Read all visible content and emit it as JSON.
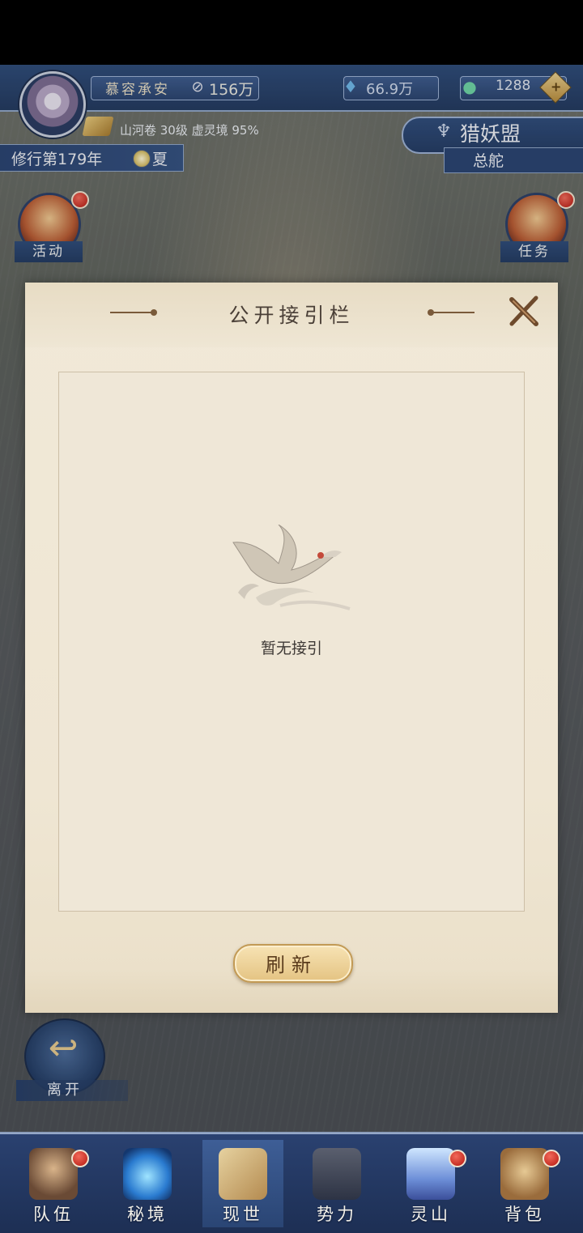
{
  "player": {
    "name": "慕容承安",
    "power": "156万",
    "realm_info": "山河卷 30级 虚灵境 95%",
    "year": "修行第179年",
    "season": "夏"
  },
  "currency": {
    "spirit_stones": "66.9万",
    "jade": "1288"
  },
  "guild": {
    "name": "猎妖盟",
    "location": "总舵"
  },
  "side_buttons": {
    "activity": "活动",
    "quest": "任务"
  },
  "dialog": {
    "title": "公开接引栏",
    "empty_text": "暂无接引",
    "refresh_label": "刷新"
  },
  "return_label": "离开",
  "nav": [
    {
      "label": "队伍",
      "badge": true
    },
    {
      "label": "秘境",
      "badge": false
    },
    {
      "label": "现世",
      "badge": false,
      "active": true
    },
    {
      "label": "势力",
      "badge": false
    },
    {
      "label": "灵山",
      "badge": true
    },
    {
      "label": "背包",
      "badge": true
    }
  ],
  "colors": {
    "header_blue": "#2e4a78",
    "parchment": "#f1e9d8",
    "badge_red": "#b5170f",
    "refresh_gold": "#e4c382"
  },
  "icons": {
    "power": "no-sword-icon",
    "spirit_stones": "crystal-icon",
    "jade": "jade-coin-icon",
    "guild": "guild-emblem-icon",
    "close": "close-icon",
    "empty": "crane-icon",
    "return": "back-arrow-icon"
  }
}
